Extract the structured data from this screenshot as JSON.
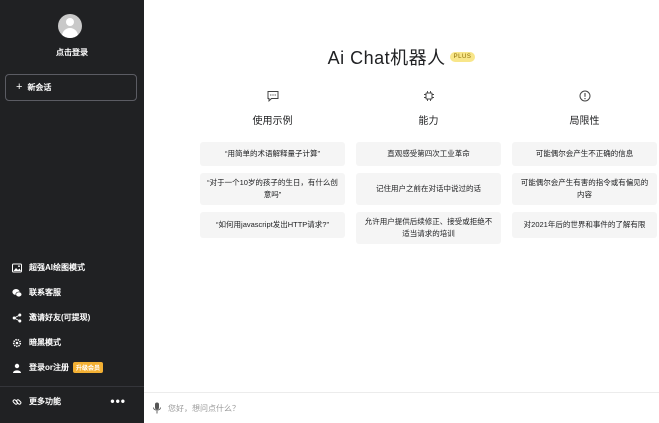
{
  "sidebar": {
    "login_label": "点击登录",
    "new_chat_label": "新会话",
    "menu": [
      {
        "label": "超强AI绘图模式",
        "icon": "image-icon"
      },
      {
        "label": "联系客服",
        "icon": "wechat-icon"
      },
      {
        "label": "邀请好友(可提现)",
        "icon": "share-icon"
      },
      {
        "label": "暗黑模式",
        "icon": "gear-icon"
      },
      {
        "label": "登录or注册",
        "icon": "user-icon",
        "badge": "升级会员"
      }
    ],
    "footer_label": "更多功能",
    "footer_dots": "•••"
  },
  "main": {
    "title": "Ai Chat机器人",
    "title_badge": "PLUS",
    "columns": [
      {
        "title": "使用示例",
        "icon": "chat-bubble-icon",
        "cards": [
          "“用简单的术语解释量子计算”",
          "“对于一个10岁的孩子的生日，有什么创意吗”",
          "“如何用javascript发出HTTP请求?”"
        ]
      },
      {
        "title": "能力",
        "icon": "chip-icon",
        "cards": [
          "直观感受第四次工业革命",
          "记住用户之前在对话中说过的话",
          "允许用户提供后续修正、接受或拒绝不适当请求的培训"
        ]
      },
      {
        "title": "局限性",
        "icon": "warning-icon",
        "cards": [
          "可能偶尔会产生不正确的信息",
          "可能偶尔会产生有害的指令或有偏见的内容",
          "对2021年后的世界和事件的了解有限"
        ]
      }
    ]
  },
  "input": {
    "placeholder": "您好，想问点什么？"
  },
  "colors": {
    "sidebar_bg": "#202123",
    "card_bg": "#f5f5f5",
    "badge_orange": "#f3b033",
    "plus_badge_bg": "#f8e68a"
  }
}
